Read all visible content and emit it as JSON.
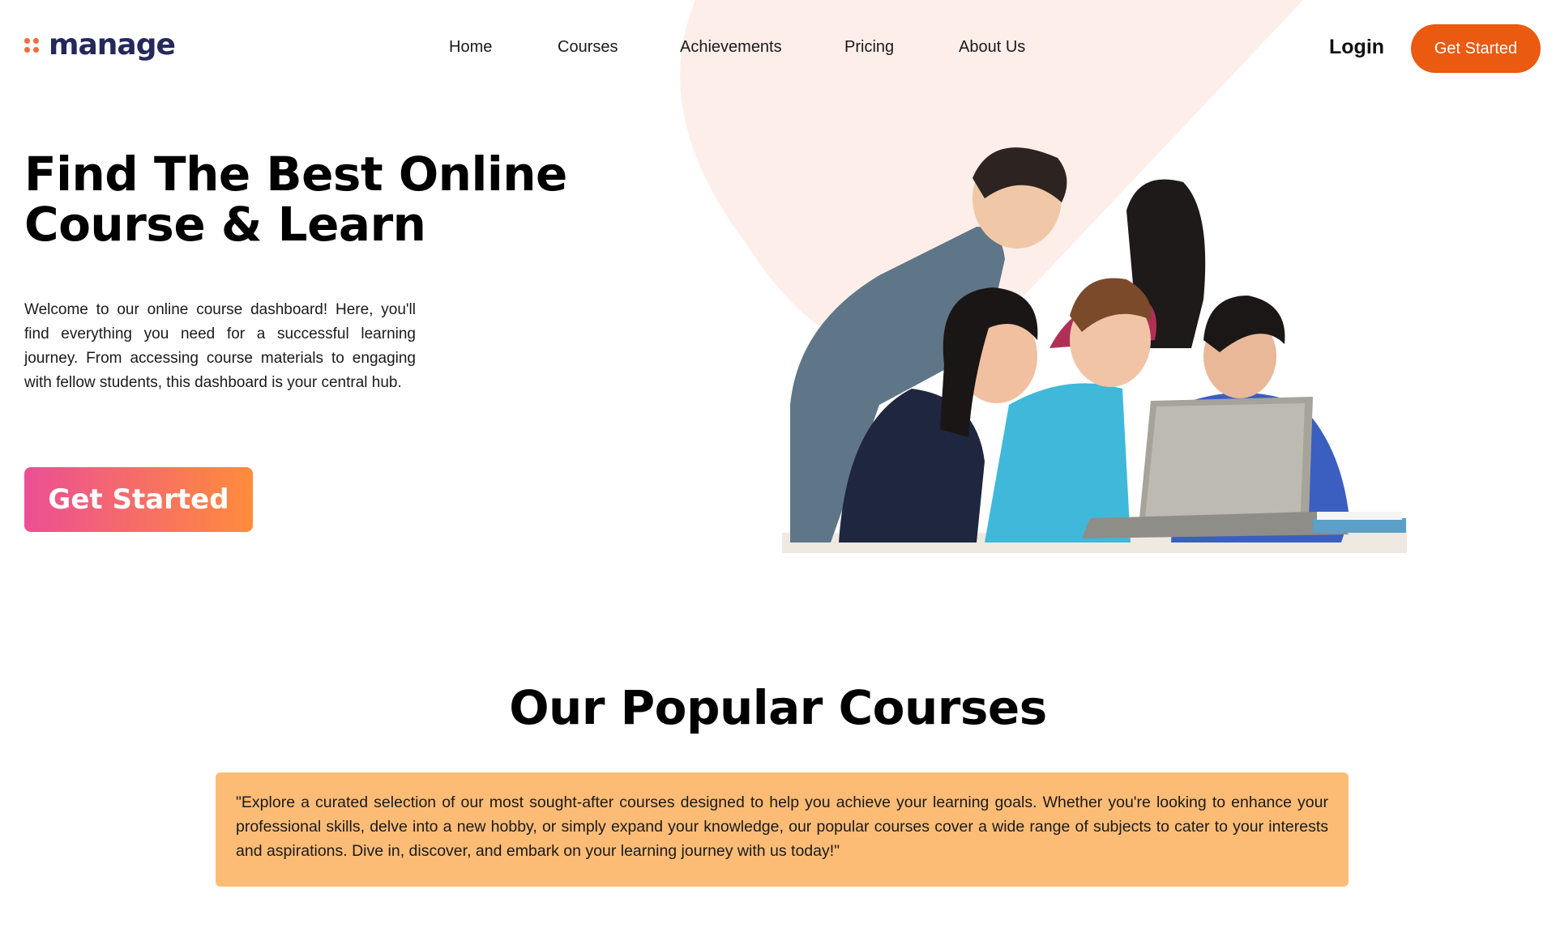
{
  "brand": {
    "name": "manage",
    "accent_color": "#f26b3a",
    "name_color": "#25285a"
  },
  "nav": {
    "items": [
      {
        "label": "Home"
      },
      {
        "label": "Courses"
      },
      {
        "label": "Achievements"
      },
      {
        "label": "Pricing"
      },
      {
        "label": "About Us"
      }
    ]
  },
  "header": {
    "login_label": "Login",
    "cta_label": "Get Started",
    "cta_color": "#ea5a10"
  },
  "hero": {
    "title_line1": "Find The Best Online",
    "title_line2": "Course & Learn",
    "description": "Welcome to our online course dashboard! Here, you'll find everything you need for a successful learning journey. From accessing course materials to engaging with fellow students, this dashboard is your central hub.",
    "cta_label": "Get Started",
    "image": "group-of-students-at-laptop"
  },
  "popular": {
    "title": "Our Popular Courses",
    "quote": "\"Explore a curated selection of our most sought-after courses designed to help you achieve your learning goals. Whether you're looking to enhance your professional skills, delve into a new hobby, or simply expand your knowledge, our popular courses cover a wide range of subjects to cater to your interests and aspirations. Dive in, discover, and embark on your learning journey with us today!\"",
    "box_color": "#fdbc76"
  }
}
